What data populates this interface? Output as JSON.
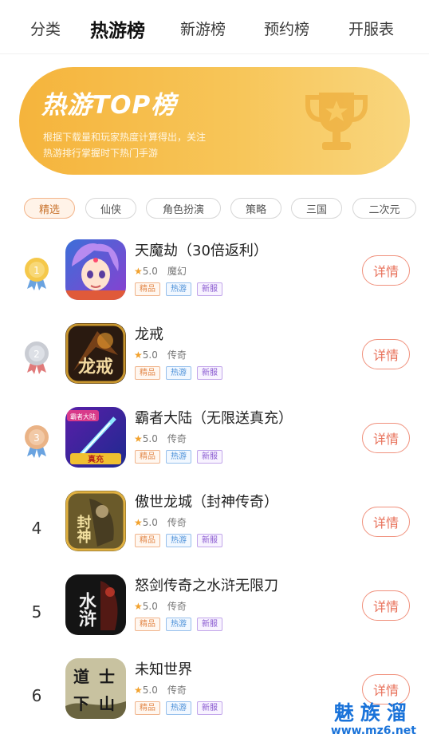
{
  "tabs": [
    {
      "label": "分类",
      "active": false
    },
    {
      "label": "热游榜",
      "active": true
    },
    {
      "label": "新游榜",
      "active": false
    },
    {
      "label": "预约榜",
      "active": false
    },
    {
      "label": "开服表",
      "active": false
    }
  ],
  "banner": {
    "title": "热游TOP榜",
    "desc_line1": "根据下载量和玩家热度计算得出，关注",
    "desc_line2": "热游排行掌握时下热门手游",
    "icon": "trophy-icon"
  },
  "chips": [
    {
      "label": "精选",
      "active": true
    },
    {
      "label": "仙侠",
      "active": false
    },
    {
      "label": "角色扮演",
      "active": false
    },
    {
      "label": "策略",
      "active": false
    },
    {
      "label": "三国",
      "active": false
    },
    {
      "label": "二次元",
      "active": false
    }
  ],
  "games": [
    {
      "rank": "1",
      "medal": "gold",
      "name": "天魔劫（30倍返利）",
      "star": "★",
      "score": "5.0",
      "genre": "魔幻",
      "tags": [
        "精品",
        "热游",
        "新服"
      ],
      "detail": "详情"
    },
    {
      "rank": "2",
      "medal": "silver",
      "name": "龙戒",
      "star": "★",
      "score": "5.0",
      "genre": "传奇",
      "tags": [
        "精品",
        "热游",
        "新服"
      ],
      "detail": "详情"
    },
    {
      "rank": "3",
      "medal": "bronze",
      "name": "霸者大陆（无限送真充）",
      "star": "★",
      "score": "5.0",
      "genre": "传奇",
      "tags": [
        "精品",
        "热游",
        "新服"
      ],
      "detail": "详情"
    },
    {
      "rank": "4",
      "medal": "",
      "name": "傲世龙城（封神传奇）",
      "star": "★",
      "score": "5.0",
      "genre": "传奇",
      "tags": [
        "精品",
        "热游",
        "新服"
      ],
      "detail": "详情"
    },
    {
      "rank": "5",
      "medal": "",
      "name": "怒剑传奇之水浒无限刀",
      "star": "★",
      "score": "5.0",
      "genre": "传奇",
      "tags": [
        "精品",
        "热游",
        "新服"
      ],
      "detail": "详情"
    },
    {
      "rank": "6",
      "medal": "",
      "name": "未知世界",
      "star": "★",
      "score": "5.0",
      "genre": "传奇",
      "tags": [
        "精品",
        "热游",
        "新服"
      ],
      "detail": "详情"
    }
  ],
  "icon_texts": {
    "g2": "龙戒",
    "g3_top": "霸者大陆",
    "g3_bottom": "真充",
    "g4": "封神",
    "g5": "水浒",
    "g6a": "道",
    "g6b": "士",
    "g6c": "下",
    "g6d": "山"
  },
  "watermark": {
    "cn": "魅族溜",
    "url": "www.mz6.net"
  },
  "colors": {
    "accent": "#e8715a",
    "banner": "#f5b43c",
    "star": "#f2a22e"
  }
}
